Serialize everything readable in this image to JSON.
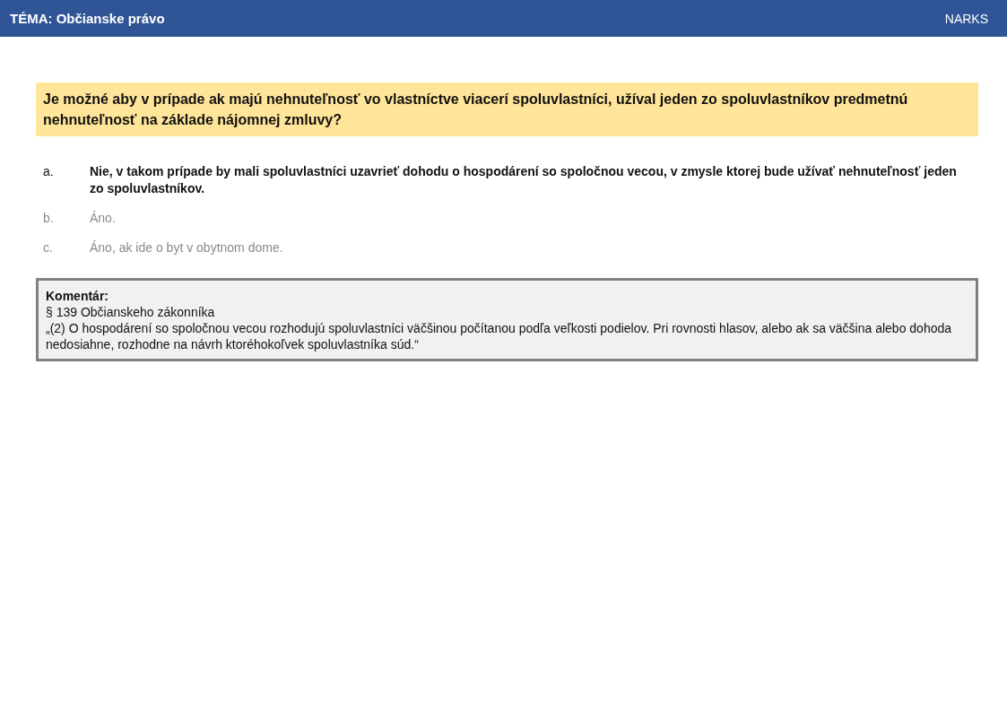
{
  "header": {
    "title": "TÉMA: Občianske právo",
    "brand": "NARKS"
  },
  "question": "Je možné aby v prípade ak majú nehnuteľnosť vo vlastníctve viacerí spoluvlastníci, užíval jeden zo spoluvlastníkov predmetnú nehnuteľnosť na základe nájomnej zmluvy?",
  "answers": [
    {
      "letter": "a.",
      "text": "Nie, v takom prípade by mali spoluvlastníci uzavrieť dohodu o hospodárení so spoločnou vecou, v zmysle ktorej bude užívať nehnuteľnosť jeden zo spoluvlastníkov.",
      "correct": true
    },
    {
      "letter": "b.",
      "text": "Áno.",
      "correct": false
    },
    {
      "letter": "c.",
      "text": "Áno, ak ide o byt v obytnom dome.",
      "correct": false
    }
  ],
  "comment": {
    "heading": "Komentár:",
    "source": "§ 139 Občianskeho zákonníka",
    "quote": "„(2) O hospodárení so spoločnou vecou rozhodujú spoluvlastníci väčšinou počítanou podľa veľkosti podielov. Pri rovnosti hlasov, alebo ak sa väčšina alebo dohoda nedosiahne, rozhodne na návrh ktoréhokoľvek spoluvlastníka súd.“"
  }
}
